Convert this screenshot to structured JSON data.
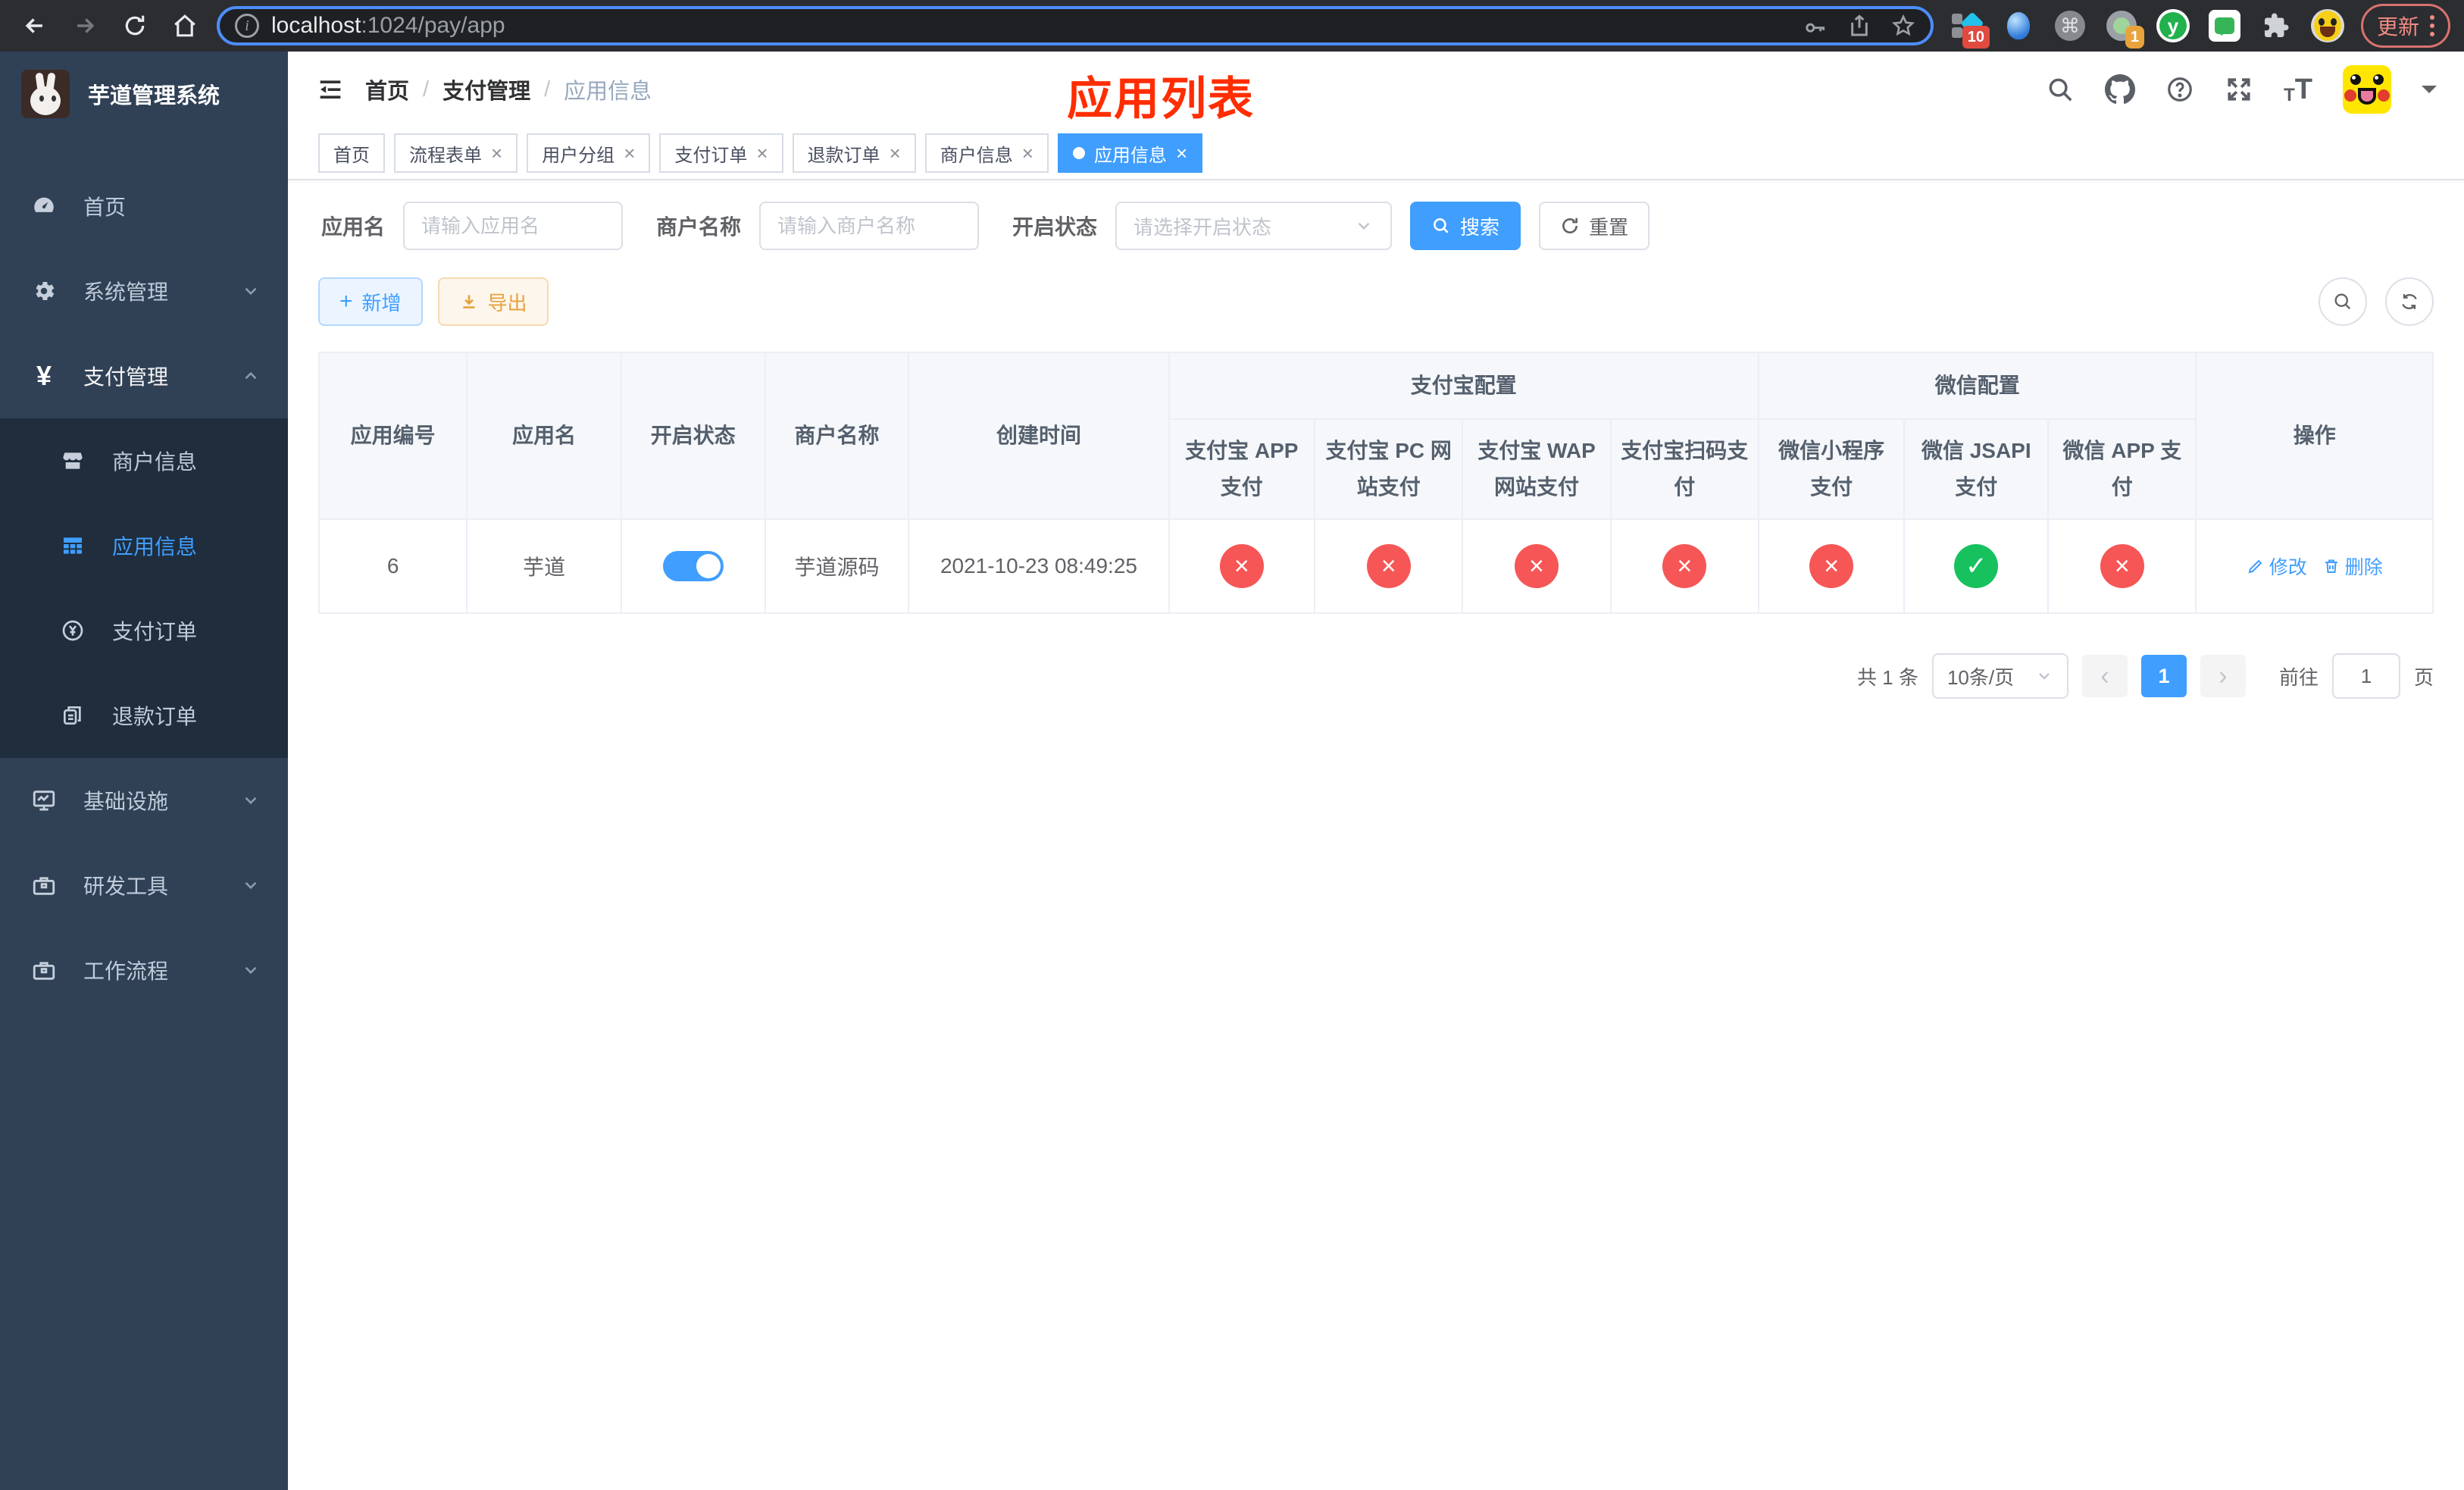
{
  "browser": {
    "url_host": "localhost",
    "url_rest": ":1024/pay/app",
    "update_button": "更新",
    "ext_badge_monkey": "10",
    "ext_badge_record": "1",
    "ext_letter": "y"
  },
  "sidebar": {
    "title": "芋道管理系统",
    "items": {
      "home": "首页",
      "system": "系统管理",
      "payment": "支付管理",
      "merchant": "商户信息",
      "app": "应用信息",
      "payorder": "支付订单",
      "refund": "退款订单",
      "infra": "基础设施",
      "devtools": "研发工具",
      "workflow": "工作流程"
    }
  },
  "header": {
    "breadcrumb": [
      "首页",
      "支付管理",
      "应用信息"
    ],
    "annotation": "应用列表"
  },
  "tabs": [
    {
      "label": "首页"
    },
    {
      "label": "流程表单"
    },
    {
      "label": "用户分组"
    },
    {
      "label": "支付订单"
    },
    {
      "label": "退款订单"
    },
    {
      "label": "商户信息"
    },
    {
      "label": "应用信息"
    }
  ],
  "filters": {
    "app_name_label": "应用名",
    "app_name_placeholder": "请输入应用名",
    "merchant_label": "商户名称",
    "merchant_placeholder": "请输入商户名称",
    "status_label": "开启状态",
    "status_placeholder": "请选择开启状态",
    "search_button": "搜索",
    "reset_button": "重置"
  },
  "toolbar": {
    "add_button": "新增",
    "export_button": "导出"
  },
  "table": {
    "groups": {
      "alipay": "支付宝配置",
      "wechat": "微信配置"
    },
    "columns": [
      "应用编号",
      "应用名",
      "开启状态",
      "商户名称",
      "创建时间",
      "支付宝 APP 支付",
      "支付宝 PC 网站支付",
      "支付宝 WAP 网站支付",
      "支付宝扫码支付",
      "微信小程序支付",
      "微信 JSAPI 支付",
      "微信 APP 支付",
      "操作"
    ],
    "rows": [
      {
        "id": "6",
        "name": "芋道",
        "enabled": true,
        "merchant": "芋道源码",
        "created": "2021-10-23 08:49:25",
        "pay_status": [
          "x",
          "x",
          "x",
          "x",
          "x",
          "check",
          "x"
        ],
        "edit_label": "修改",
        "delete_label": "删除"
      }
    ]
  },
  "pagination": {
    "total": "共 1 条",
    "page_size": "10条/页",
    "current_page": "1",
    "goto_label": "前往",
    "goto_value": "1",
    "page_unit": "页"
  }
}
